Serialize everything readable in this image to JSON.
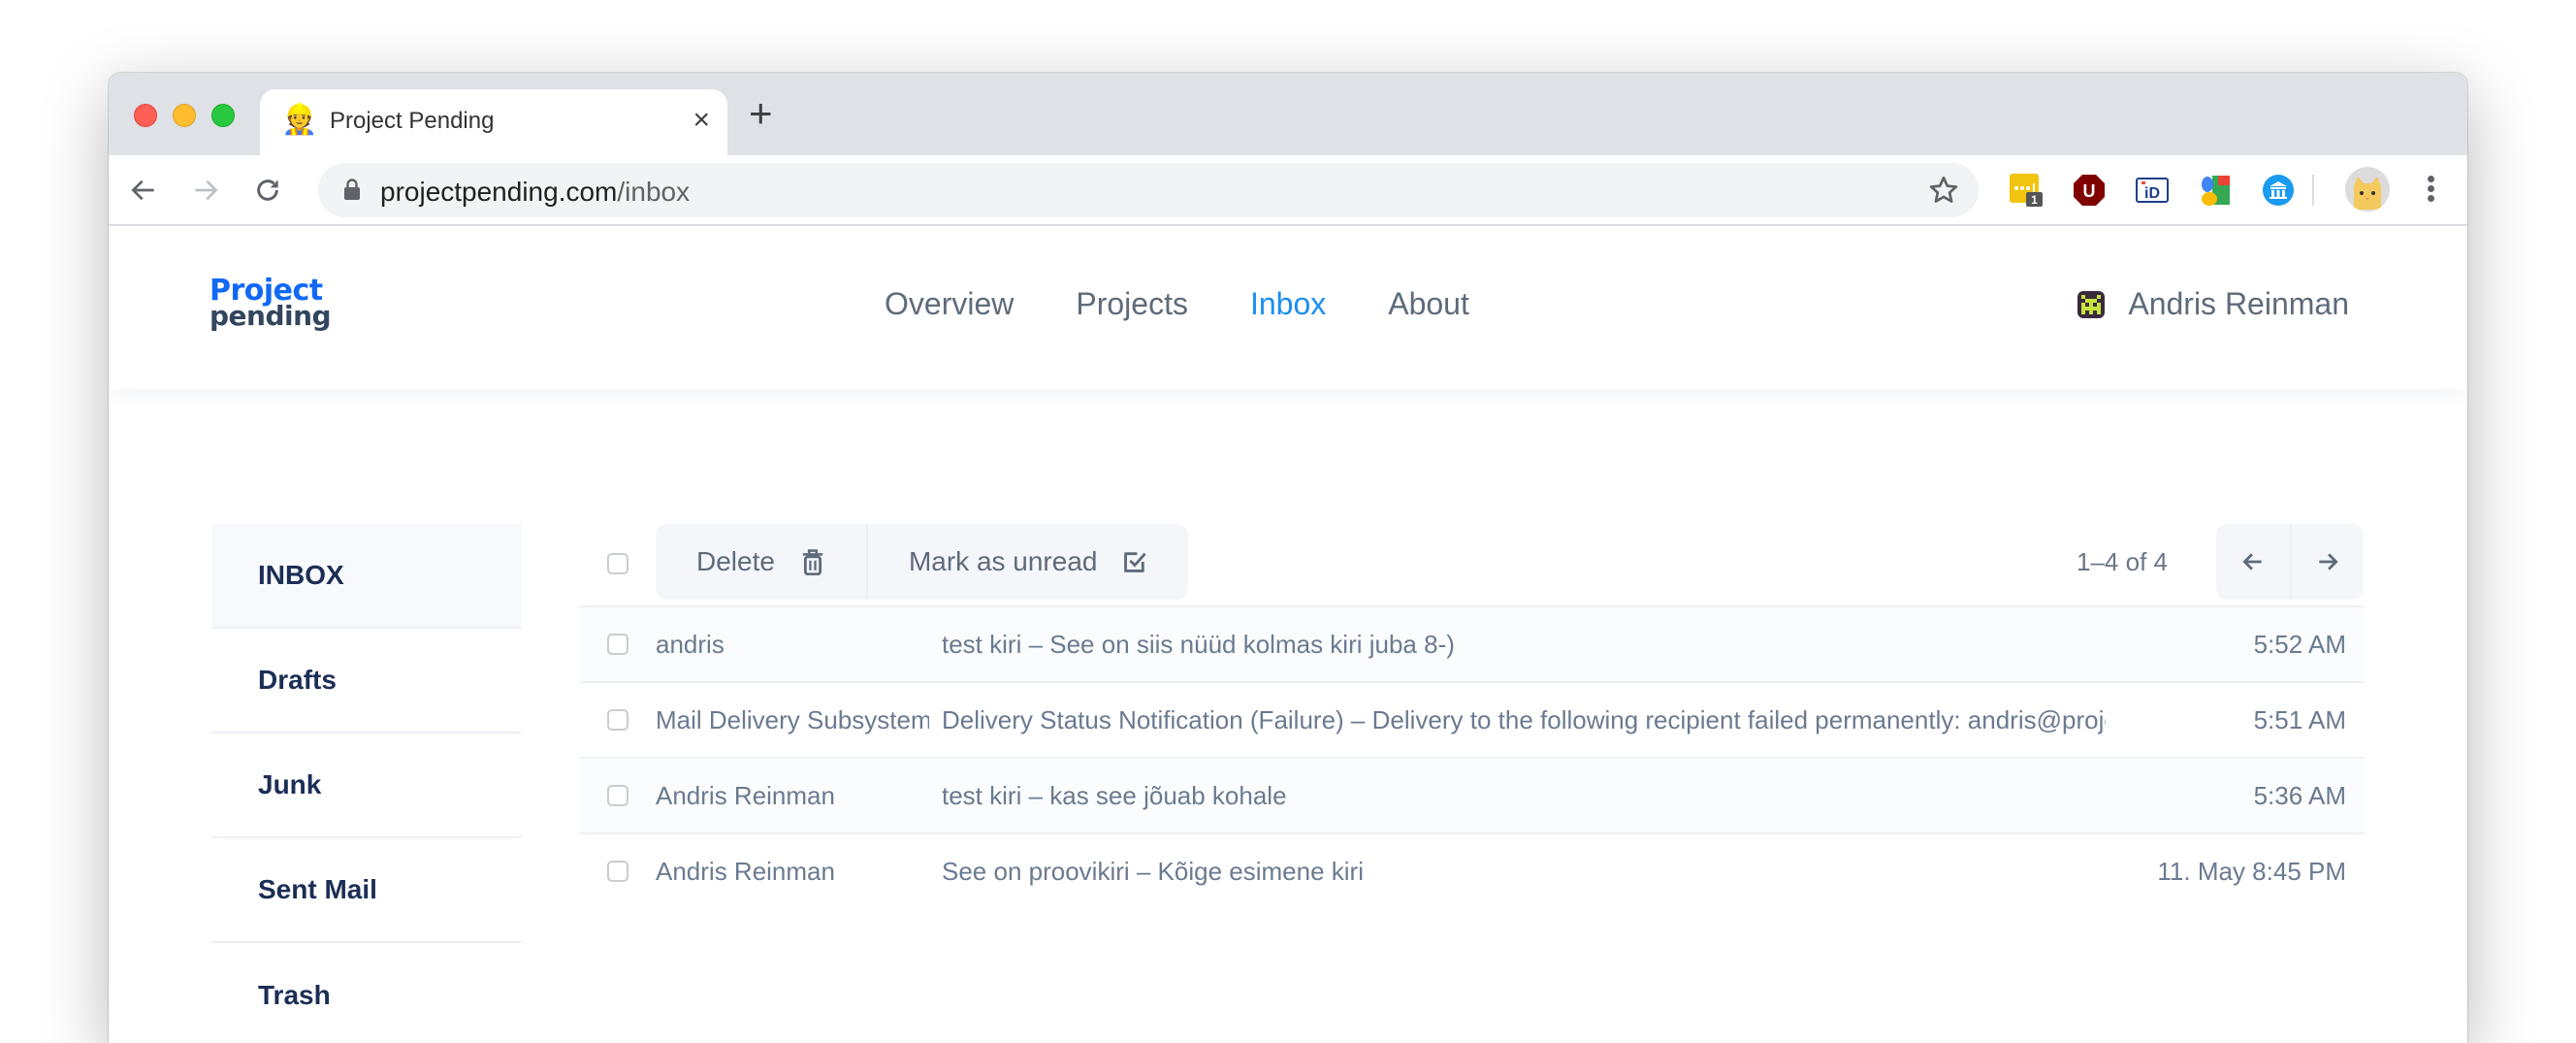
{
  "browser": {
    "tab": {
      "favicon": "👷",
      "title": "Project Pending",
      "close_label": "×"
    },
    "new_tab_label": "+",
    "url_host": "projectpending.com",
    "url_path": "/inbox",
    "extensions": [
      {
        "name": "lastpass-extension-icon",
        "badge": "1",
        "color": "#f1c40f"
      },
      {
        "name": "ublock-extension-icon",
        "glyph": "U",
        "color": "#800000"
      },
      {
        "name": "id-extension-icon",
        "glyph": "iD",
        "color": "#1d3f8a"
      },
      {
        "name": "google-extension-icon"
      },
      {
        "name": "museum-extension-icon",
        "color": "#1a9bf0"
      }
    ]
  },
  "header": {
    "logo_line1": "Project",
    "logo_line2": "pending",
    "nav": [
      {
        "label": "Overview",
        "active": false
      },
      {
        "label": "Projects",
        "active": false
      },
      {
        "label": "Inbox",
        "active": true
      },
      {
        "label": "About",
        "active": false
      }
    ],
    "user_name": "Andris Reinman"
  },
  "sidebar": {
    "items": [
      {
        "label": "INBOX",
        "active": true
      },
      {
        "label": "Drafts",
        "active": false
      },
      {
        "label": "Junk",
        "active": false
      },
      {
        "label": "Sent Mail",
        "active": false
      },
      {
        "label": "Trash",
        "active": false
      }
    ]
  },
  "toolbar": {
    "delete_label": "Delete",
    "mark_unread_label": "Mark as unread",
    "pagination_text": "1–4 of 4"
  },
  "messages": [
    {
      "sender": "andris",
      "subject": "test kiri – See on siis nüüd kolmas kiri juba 8-)",
      "time": "5:52 AM"
    },
    {
      "sender": "Mail Delivery Subsystem",
      "subject": "Delivery Status Notification (Failure) – Delivery to the following recipient failed permanently: andris@projectpending.com",
      "time": "5:51 AM"
    },
    {
      "sender": "Andris Reinman",
      "subject": "test kiri – kas see jõuab kohale",
      "time": "5:36 AM"
    },
    {
      "sender": "Andris Reinman",
      "subject": "See on proovikiri – Kõige esimene kiri",
      "time": "11. May 8:45 PM"
    }
  ],
  "colors": {
    "accent": "#1b8ef2",
    "logo_blue": "#1168f5",
    "logo_dark": "#33465e",
    "sidebar_text": "#1c2e55",
    "muted_text": "#6b7a90"
  }
}
